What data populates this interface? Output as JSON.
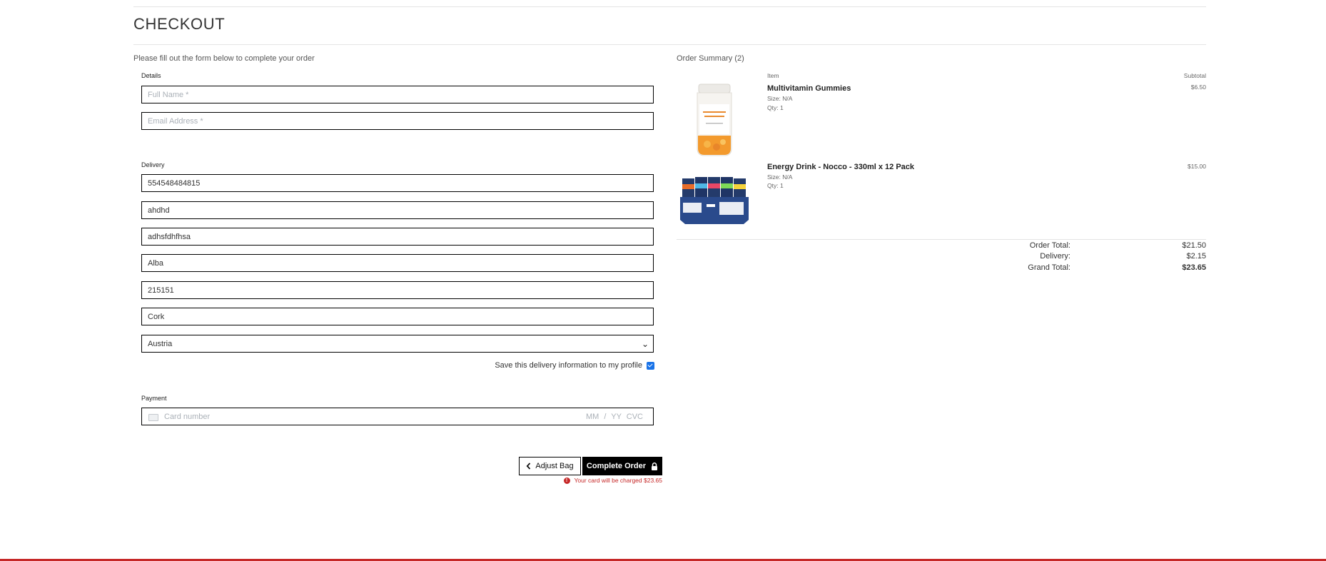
{
  "header": {
    "title": "CHECKOUT"
  },
  "form": {
    "lead": "Please fill out the form below to complete your order",
    "details_label": "Details",
    "full_name_placeholder": "Full Name *",
    "email_placeholder": "Email Address *",
    "delivery_label": "Delivery",
    "phone_value": "554548484815",
    "postcode_value": "ahdhd",
    "town_value": "adhsfdhfhsa",
    "street1_value": "Alba",
    "street2_value": "215151",
    "county_value": "Cork",
    "country_selected": "Austria",
    "save_info_label": "Save this delivery information to my profile",
    "save_info_checked": true,
    "payment_label": "Payment",
    "card_placeholder": "Card number",
    "expiry_cvc_placeholder": "MM / YY CVC",
    "adjust_bag_label": "Adjust Bag",
    "complete_order_label": "Complete Order",
    "charge_note": "Your card will be charged $23.65"
  },
  "summary": {
    "title": "Order Summary (2)",
    "col_item": "Item",
    "col_subtotal": "Subtotal",
    "items": [
      {
        "name": "Multivitamin Gummies",
        "size": "Size: N/A",
        "qty": "Qty: 1",
        "price": "$6.50",
        "image_icon": "gummies-bottle"
      },
      {
        "name": "Energy Drink - Nocco - 330ml x 12 Pack",
        "size": "Size: N/A",
        "qty": "Qty: 1",
        "price": "$15.00",
        "image_icon": "nocco-bcaa-pack"
      }
    ],
    "order_total_label": "Order Total:",
    "order_total": "$21.50",
    "delivery_label": "Delivery:",
    "delivery": "$2.15",
    "grand_total_label": "Grand Total:",
    "grand_total": "$23.65"
  },
  "colors": {
    "accent": "#c62828",
    "primary_button": "#000000",
    "checkbox": "#1a73e8"
  }
}
